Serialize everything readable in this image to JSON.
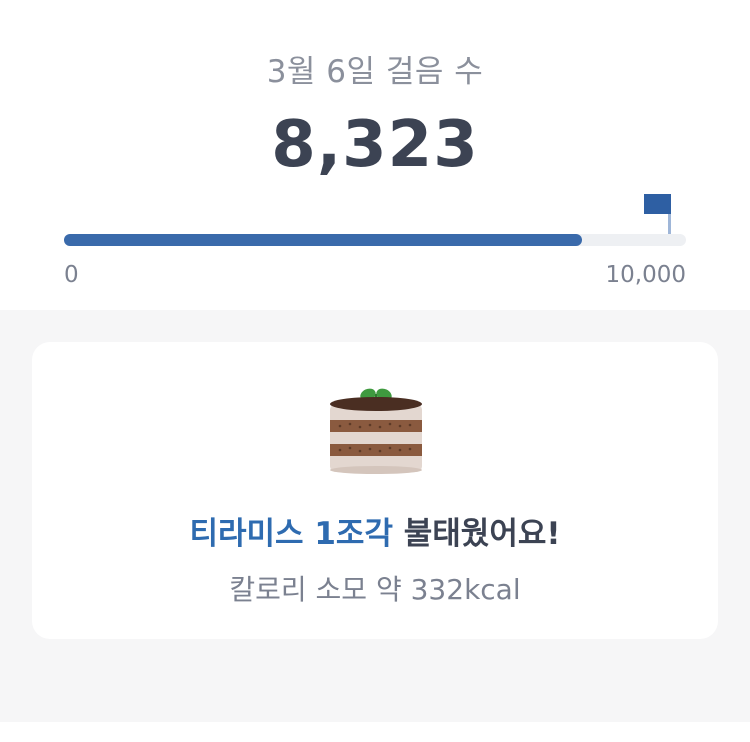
{
  "header": {
    "date_label": "3월 6일 걸음 수",
    "step_count": "8,323"
  },
  "progress": {
    "min_label": "0",
    "max_label": "10,000",
    "fraction": 0.8323,
    "color": "#3a6aab",
    "track_color": "#eef0f3"
  },
  "card": {
    "icon": "tiramisu-cake-icon",
    "food_highlight": "티라미스 1조각",
    "burn_suffix": " 불태웠어요!",
    "calorie_text": "칼로리 소모 약 332kcal",
    "highlight_color": "#2e6bb0"
  },
  "goal_icon": "flag-icon"
}
